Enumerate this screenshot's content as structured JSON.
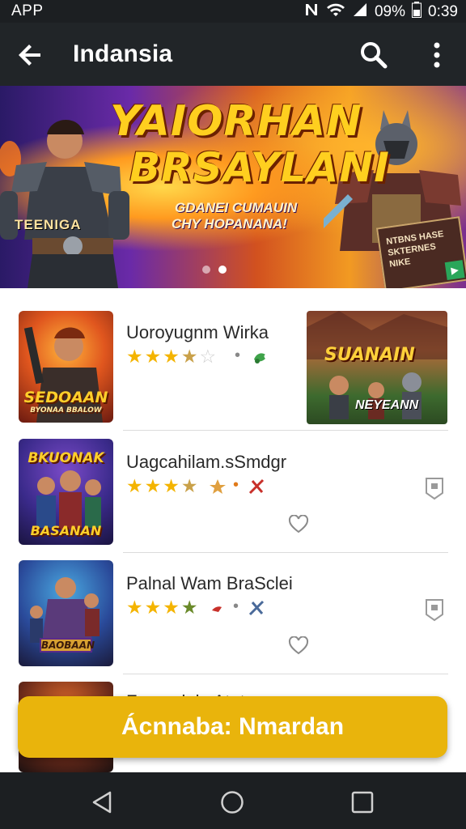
{
  "status_bar": {
    "carrier": "APP",
    "battery": "09%",
    "time": "0:39",
    "icons": [
      "nfc-icon",
      "wifi-icon",
      "signal-icon",
      "battery-icon"
    ]
  },
  "app_bar": {
    "title": "Indansia",
    "icons": [
      "back-arrow-icon",
      "search-icon",
      "more-vert-icon"
    ]
  },
  "banner": {
    "title_line1": "YAIORHAN",
    "title_line2": "BRSAYLANI",
    "subtitle_line1": "GDANEI CUMAUIN",
    "subtitle_line2": "CHY HOPANANA!",
    "hero_label": "TEENIGA",
    "card_text": "NTBNS HASE SKTERNES NIKE",
    "carousel_pages": 2,
    "carousel_active": 1
  },
  "list": {
    "items": [
      {
        "title": "Uoroyugnm Wirka",
        "thumb_text": "SEDOAAN",
        "thumb_subtext": "BYONAA BBALOW",
        "rating": 3.5,
        "promo_title": "SUANAIN",
        "promo_subtitle": "NEYEANN"
      },
      {
        "title": "Uagcahilam.sSmdgr",
        "thumb_text": "BKUONAK",
        "thumb_bottom": "BASANAN",
        "rating": 3.5
      },
      {
        "title": "Palnal Wam BraSclei",
        "thumb_text": "BAOBAAN",
        "rating": 3.5
      },
      {
        "title": "Fanmaiaia Atntne"
      }
    ]
  },
  "install_button": {
    "label": "Ácnnaba: Nmardan"
  },
  "nav_bar": {
    "icons": [
      "nav-back-icon",
      "nav-home-icon",
      "nav-recents-icon"
    ]
  },
  "colors": {
    "app_bar_bg": "#212528",
    "status_bar_bg": "#1c1f22",
    "accent": "#e9b40c",
    "star": "#f4b400"
  }
}
